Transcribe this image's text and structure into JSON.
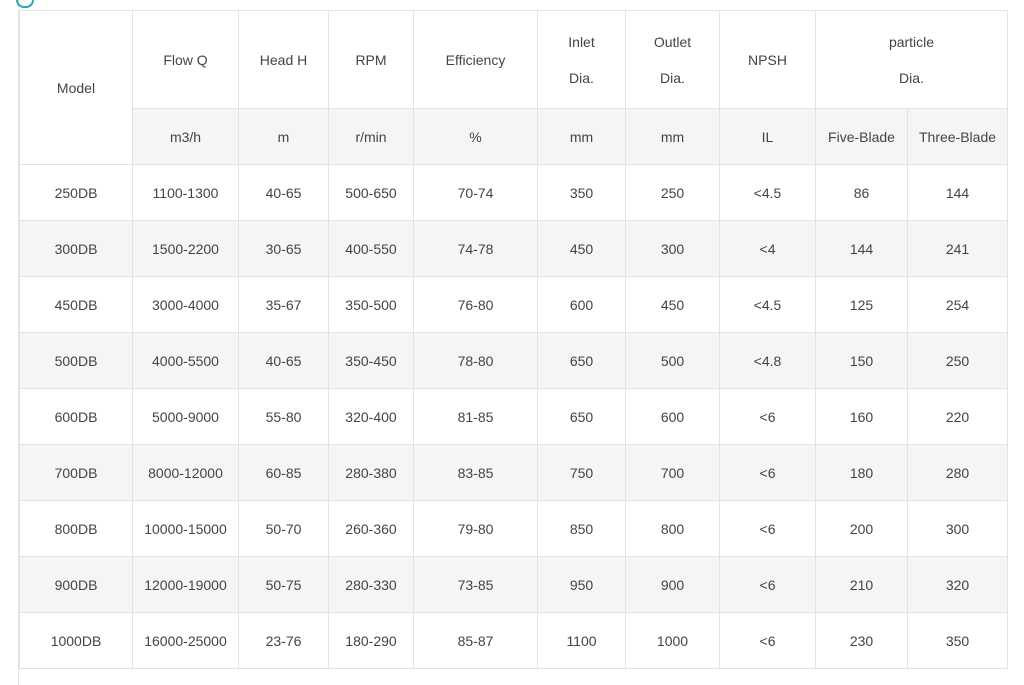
{
  "header": {
    "model": "Model",
    "flow": "Flow Q",
    "head": "Head H",
    "rpm": "RPM",
    "efficiency": "Efficiency",
    "inlet_line1": "Inlet",
    "inlet_line2": "Dia.",
    "outlet_line1": "Outlet",
    "outlet_line2": "Dia.",
    "npsh": "NPSH",
    "particle_line1": "particle",
    "particle_line2": "Dia."
  },
  "units": {
    "flow": "m3/h",
    "head": "m",
    "rpm": "r/min",
    "efficiency": "%",
    "inlet": "mm",
    "outlet": "mm",
    "npsh": "IL",
    "five_blade": "Five-Blade",
    "three_blade": "Three-Blade"
  },
  "rows": [
    {
      "model": "250DB",
      "flow": "1100-1300",
      "head": "40-65",
      "rpm": "500-650",
      "efficiency": "70-74",
      "inlet": "350",
      "outlet": "250",
      "npsh": "<4.5",
      "five": "86",
      "three": "144"
    },
    {
      "model": "300DB",
      "flow": "1500-2200",
      "head": "30-65",
      "rpm": "400-550",
      "efficiency": "74-78",
      "inlet": "450",
      "outlet": "300",
      "npsh": "<4",
      "five": "144",
      "three": "241"
    },
    {
      "model": "450DB",
      "flow": "3000-4000",
      "head": "35-67",
      "rpm": "350-500",
      "efficiency": "76-80",
      "inlet": "600",
      "outlet": "450",
      "npsh": "<4.5",
      "five": "125",
      "three": "254"
    },
    {
      "model": "500DB",
      "flow": "4000-5500",
      "head": "40-65",
      "rpm": "350-450",
      "efficiency": "78-80",
      "inlet": "650",
      "outlet": "500",
      "npsh": "<4.8",
      "five": "150",
      "three": "250"
    },
    {
      "model": "600DB",
      "flow": "5000-9000",
      "head": "55-80",
      "rpm": "320-400",
      "efficiency": "81-85",
      "inlet": "650",
      "outlet": "600",
      "npsh": "<6",
      "five": "160",
      "three": "220"
    },
    {
      "model": "700DB",
      "flow": "8000-12000",
      "head": "60-85",
      "rpm": "280-380",
      "efficiency": "83-85",
      "inlet": "750",
      "outlet": "700",
      "npsh": "<6",
      "five": "180",
      "three": "280"
    },
    {
      "model": "800DB",
      "flow": "10000-15000",
      "head": "50-70",
      "rpm": "260-360",
      "efficiency": "79-80",
      "inlet": "850",
      "outlet": "800",
      "npsh": "<6",
      "five": "200",
      "three": "300"
    },
    {
      "model": "900DB",
      "flow": "12000-19000",
      "head": "50-75",
      "rpm": "280-330",
      "efficiency": "73-85",
      "inlet": "950",
      "outlet": "900",
      "npsh": "<6",
      "five": "210",
      "three": "320"
    },
    {
      "model": "1000DB",
      "flow": "16000-25000",
      "head": "23-76",
      "rpm": "180-290",
      "efficiency": "85-87",
      "inlet": "1100",
      "outlet": "1000",
      "npsh": "<6",
      "five": "230",
      "three": "350"
    }
  ]
}
